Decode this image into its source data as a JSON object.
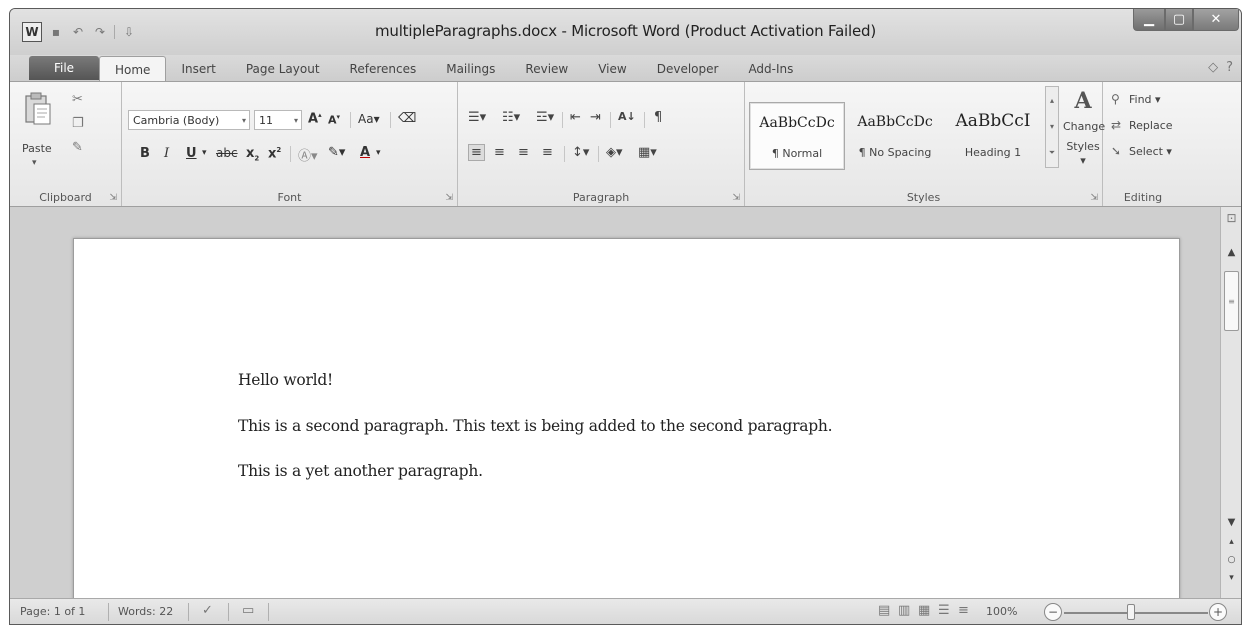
{
  "window": {
    "title": "multipleParagraphs.docx - Microsoft Word (Product Activation Failed)",
    "app_icon": "W",
    "qat_icons": [
      "save-icon",
      "undo-icon",
      "redo-icon",
      "customize-qat-icon"
    ]
  },
  "tabs": {
    "file": "File",
    "items": [
      "Home",
      "Insert",
      "Page Layout",
      "References",
      "Mailings",
      "Review",
      "View",
      "Developer",
      "Add-Ins"
    ],
    "active": "Home"
  },
  "ribbon": {
    "clipboard": {
      "label": "Clipboard",
      "paste": "Paste"
    },
    "font": {
      "label": "Font",
      "font_name": "Cambria (Body)",
      "font_size": "11"
    },
    "paragraph": {
      "label": "Paragraph"
    },
    "styles": {
      "label": "Styles",
      "items": [
        {
          "sample": "AaBbCcDc",
          "name": "¶ Normal"
        },
        {
          "sample": "AaBbCcDc",
          "name": "¶ No Spacing"
        },
        {
          "sample": "AaBbCcI",
          "name": "Heading 1"
        }
      ],
      "change_styles_line1": "Change",
      "change_styles_line2": "Styles ▾"
    },
    "editing": {
      "label": "Editing",
      "find": "Find ▾",
      "replace": "Replace",
      "select": "Select ▾"
    }
  },
  "document": {
    "paragraphs": [
      "Hello world!",
      "This is a second paragraph. This text is being added to the second paragraph.",
      "This is a yet another paragraph."
    ]
  },
  "statusbar": {
    "page": "Page: 1 of 1",
    "words": "Words: 22",
    "zoom": "100%"
  },
  "colors": {
    "file_tab": "#666666",
    "chrome": "#d6d6d6",
    "page": "#ffffff"
  }
}
